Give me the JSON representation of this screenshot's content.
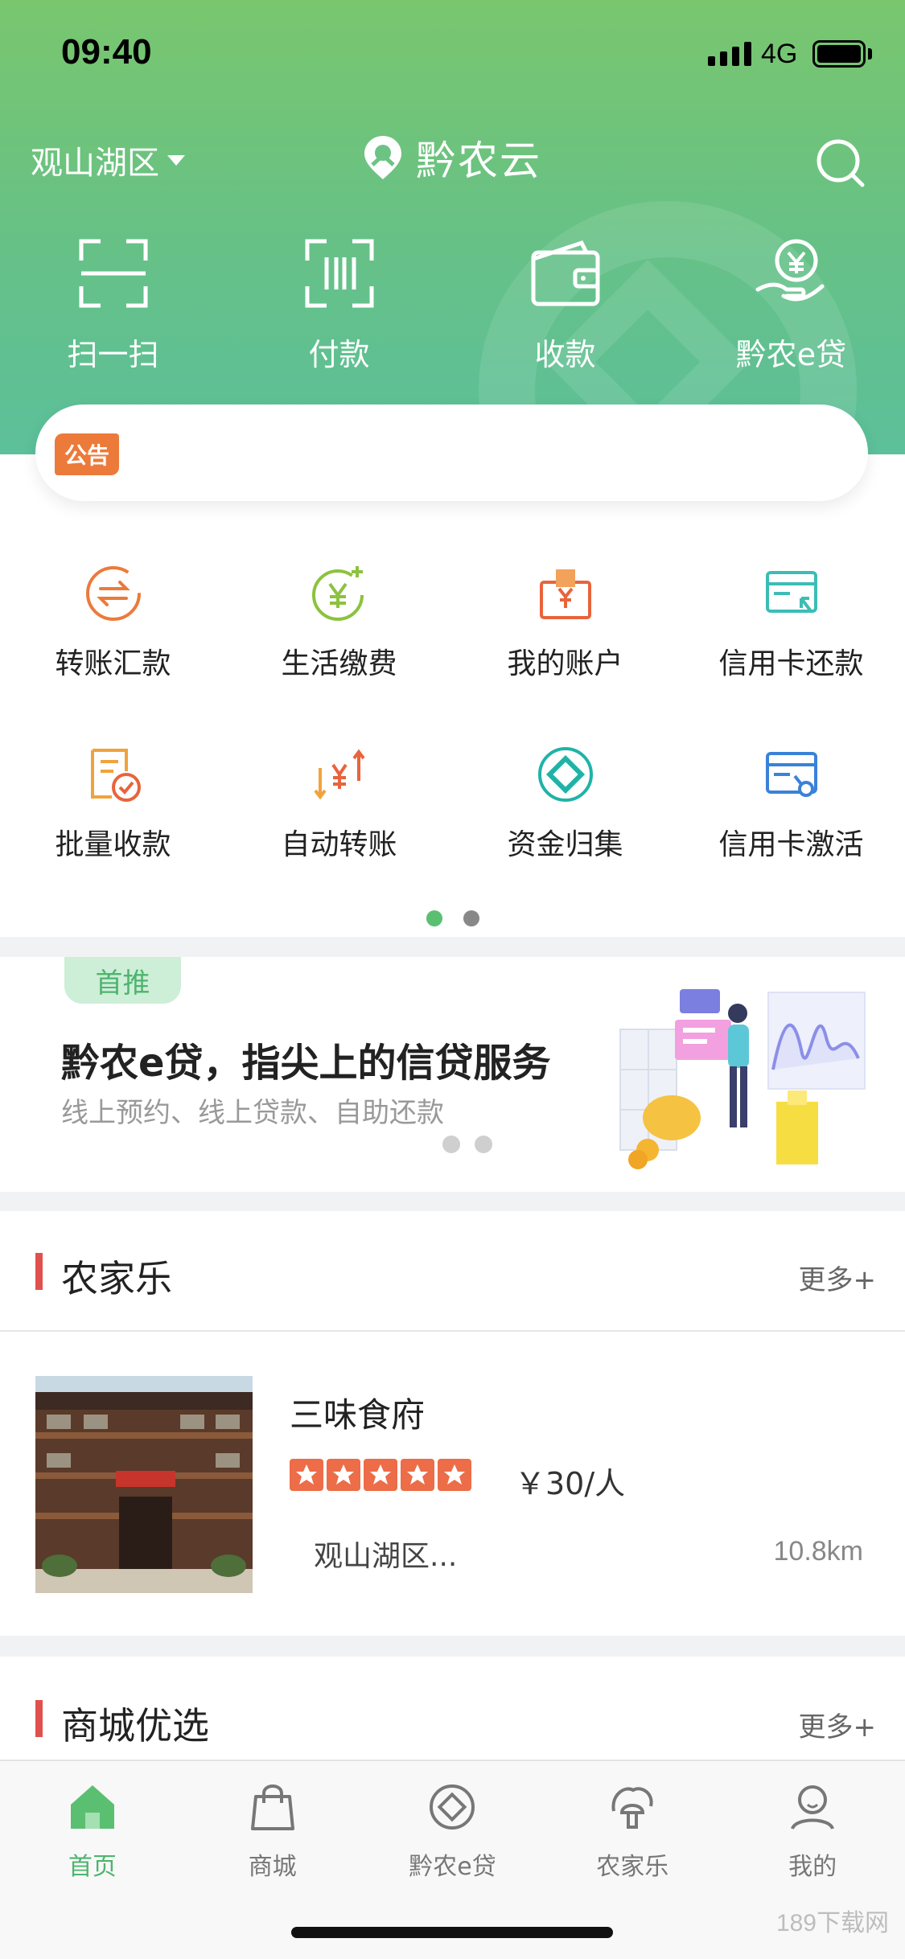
{
  "status_bar": {
    "time": "09:40",
    "network": "4G"
  },
  "header": {
    "location": "观山湖区",
    "app_title": "黔农云",
    "quick_actions": [
      {
        "label": "扫一扫",
        "icon": "scan-icon"
      },
      {
        "label": "付款",
        "icon": "payment-code-icon"
      },
      {
        "label": "收款",
        "icon": "wallet-icon"
      },
      {
        "label": "黔农e贷",
        "icon": "loan-hand-icon"
      }
    ]
  },
  "notice": {
    "tag": "公告"
  },
  "services": {
    "items": [
      {
        "label": "转账汇款",
        "icon": "transfer-icon"
      },
      {
        "label": "生活缴费",
        "icon": "bill-payment-icon"
      },
      {
        "label": "我的账户",
        "icon": "account-icon"
      },
      {
        "label": "信用卡还款",
        "icon": "card-repay-icon"
      },
      {
        "label": "批量收款",
        "icon": "batch-collect-icon"
      },
      {
        "label": "自动转账",
        "icon": "auto-transfer-icon"
      },
      {
        "label": "资金归集",
        "icon": "fund-pool-icon"
      },
      {
        "label": "信用卡激活",
        "icon": "card-activate-icon"
      }
    ],
    "page_index": 1,
    "page_count": 2
  },
  "promo": {
    "tag": "首推",
    "title": "黔农e贷，指尖上的信贷服务",
    "subtitle": "线上预约、线上贷款、自助还款"
  },
  "farm_section": {
    "title": "农家乐",
    "more": "更多+",
    "items": [
      {
        "name": "三味食府",
        "rating": 5,
        "price": "￥30/人",
        "address": "观山湖区...",
        "distance": "10.8km"
      }
    ]
  },
  "mall_section": {
    "title": "商城优选",
    "more": "更多+"
  },
  "tab_bar": {
    "tabs": [
      {
        "label": "首页",
        "icon": "home-icon",
        "active": true
      },
      {
        "label": "商城",
        "icon": "shopping-bag-icon",
        "active": false
      },
      {
        "label": "黔农e贷",
        "icon": "loan-icon",
        "active": false
      },
      {
        "label": "农家乐",
        "icon": "farm-icon",
        "active": false
      },
      {
        "label": "我的",
        "icon": "profile-icon",
        "active": false
      }
    ]
  },
  "watermark": "189下载网",
  "colors": {
    "brand_green": "#5bbf72",
    "accent_orange": "#ec7a3a",
    "section_red": "#e0514e"
  }
}
